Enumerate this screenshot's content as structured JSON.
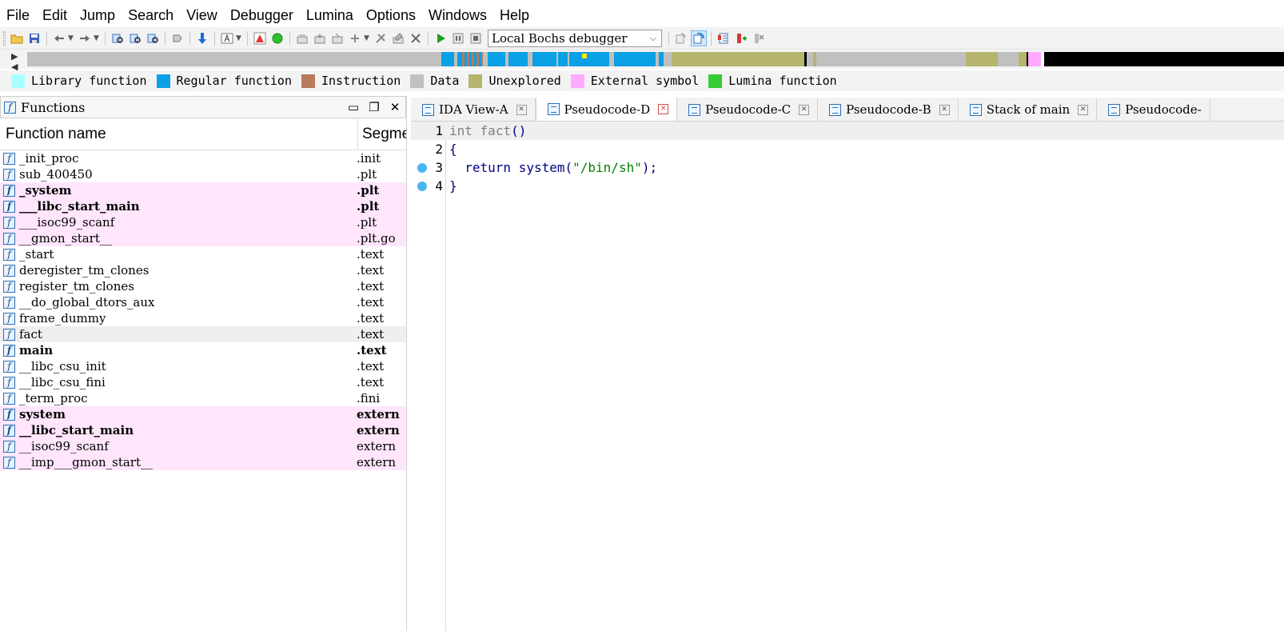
{
  "menu": [
    "File",
    "Edit",
    "Jump",
    "Search",
    "View",
    "Debugger",
    "Lumina",
    "Options",
    "Windows",
    "Help"
  ],
  "toolbar": {
    "debugger_select": "Local Bochs debugger"
  },
  "legend": [
    {
      "label": "Library function",
      "color": "#aaffff"
    },
    {
      "label": "Regular function",
      "color": "#0aa0e6"
    },
    {
      "label": "Instruction",
      "color": "#b87a5a"
    },
    {
      "label": "Data",
      "color": "#c0c0c0"
    },
    {
      "label": "Unexplored",
      "color": "#b5b56e"
    },
    {
      "label": "External symbol",
      "color": "#ffaaff"
    },
    {
      "label": "Lumina function",
      "color": "#33cc33"
    }
  ],
  "functions_pane": {
    "title": "Functions",
    "col_name": "Function name",
    "col_segment": "Segme",
    "rows": [
      {
        "name": "_init_proc",
        "segment": ".init",
        "kind": "normal"
      },
      {
        "name": "sub_400450",
        "segment": ".plt",
        "kind": "normal"
      },
      {
        "name": "_system",
        "segment": ".plt",
        "kind": "ext-bold"
      },
      {
        "name": "___libc_start_main",
        "segment": ".plt",
        "kind": "ext-bold"
      },
      {
        "name": "___isoc99_scanf",
        "segment": ".plt",
        "kind": "ext"
      },
      {
        "name": "__gmon_start__",
        "segment": ".plt.go",
        "kind": "ext"
      },
      {
        "name": "_start",
        "segment": ".text",
        "kind": "normal"
      },
      {
        "name": "deregister_tm_clones",
        "segment": ".text",
        "kind": "normal"
      },
      {
        "name": "register_tm_clones",
        "segment": ".text",
        "kind": "normal"
      },
      {
        "name": "__do_global_dtors_aux",
        "segment": ".text",
        "kind": "normal"
      },
      {
        "name": "frame_dummy",
        "segment": ".text",
        "kind": "normal"
      },
      {
        "name": "fact",
        "segment": ".text",
        "kind": "selected"
      },
      {
        "name": "main",
        "segment": ".text",
        "kind": "bold"
      },
      {
        "name": "__libc_csu_init",
        "segment": ".text",
        "kind": "normal"
      },
      {
        "name": "__libc_csu_fini",
        "segment": ".text",
        "kind": "normal"
      },
      {
        "name": "_term_proc",
        "segment": ".fini",
        "kind": "normal"
      },
      {
        "name": "system",
        "segment": "extern",
        "kind": "ext-bold"
      },
      {
        "name": "__libc_start_main",
        "segment": "extern",
        "kind": "ext-bold"
      },
      {
        "name": "__isoc99_scanf",
        "segment": "extern",
        "kind": "ext"
      },
      {
        "name": "__imp___gmon_start__",
        "segment": "extern",
        "kind": "ext"
      }
    ]
  },
  "tabs": [
    {
      "label": "IDA View-A",
      "active": false
    },
    {
      "label": "Pseudocode-D",
      "active": true
    },
    {
      "label": "Pseudocode-C",
      "active": false
    },
    {
      "label": "Pseudocode-B",
      "active": false
    },
    {
      "label": "Stack of main",
      "active": false
    },
    {
      "label": "Pseudocode-",
      "active": false
    }
  ],
  "code": {
    "line_numbers": [
      "1",
      "2",
      "3",
      "4"
    ],
    "line1": {
      "kw": "int",
      "fn": "fact",
      "paren": "()"
    },
    "line2": "{",
    "line3": {
      "ret": "return",
      "call": "system(",
      "str": "\"/bin/sh\"",
      "end": ");"
    },
    "line4": "}"
  }
}
